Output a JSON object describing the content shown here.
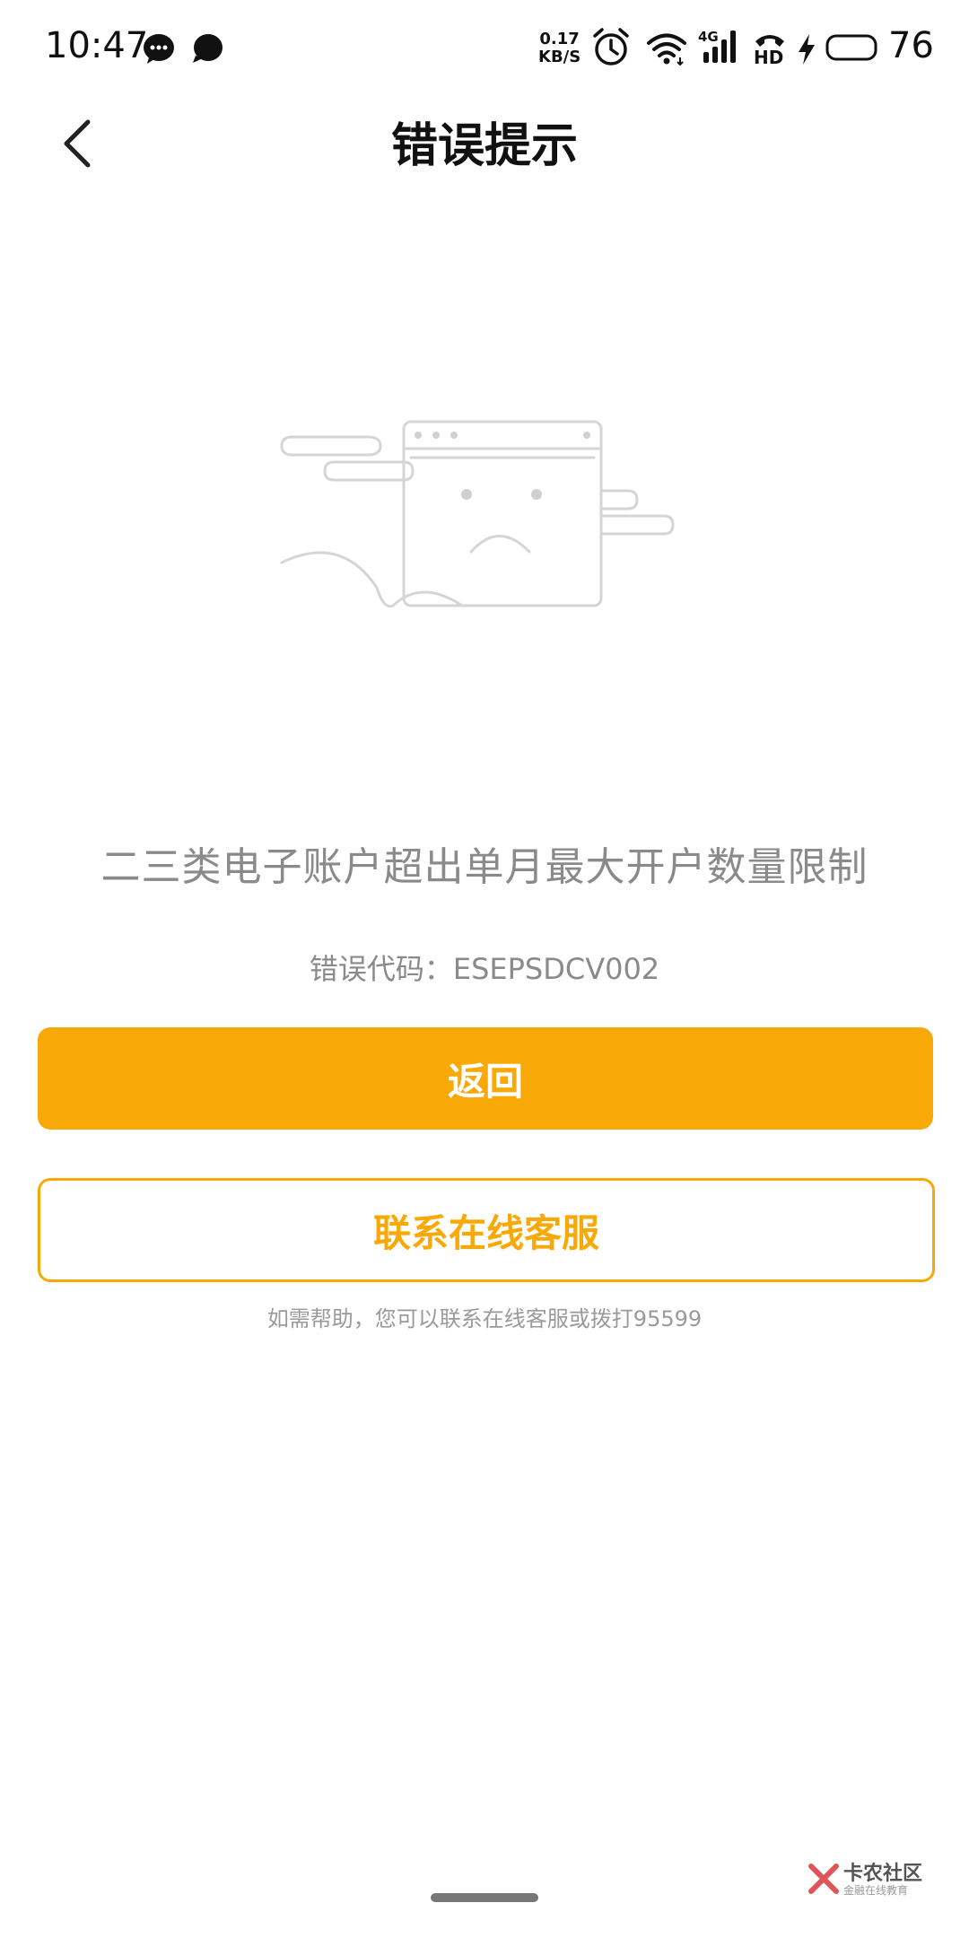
{
  "status_bar": {
    "time": "10:47",
    "network_speed": "0.17",
    "network_speed_unit": "KB/S",
    "network_type": "4G",
    "hd_label": "HD",
    "battery": "76"
  },
  "header": {
    "title": "错误提示"
  },
  "error": {
    "message": "二三类电子账户超出单月最大开户数量限制",
    "code_label": "错误代码：",
    "code_value": "ESEPSDCV002"
  },
  "actions": {
    "return_label": "返回",
    "contact_label": "联系在线客服"
  },
  "help_text": "如需帮助，您可以联系在线客服或拨打95599",
  "watermark": {
    "title": "卡农社区",
    "subtitle": "金融在线教育"
  },
  "colors": {
    "accent": "#f9a907",
    "text_muted": "#8a8a8a"
  }
}
